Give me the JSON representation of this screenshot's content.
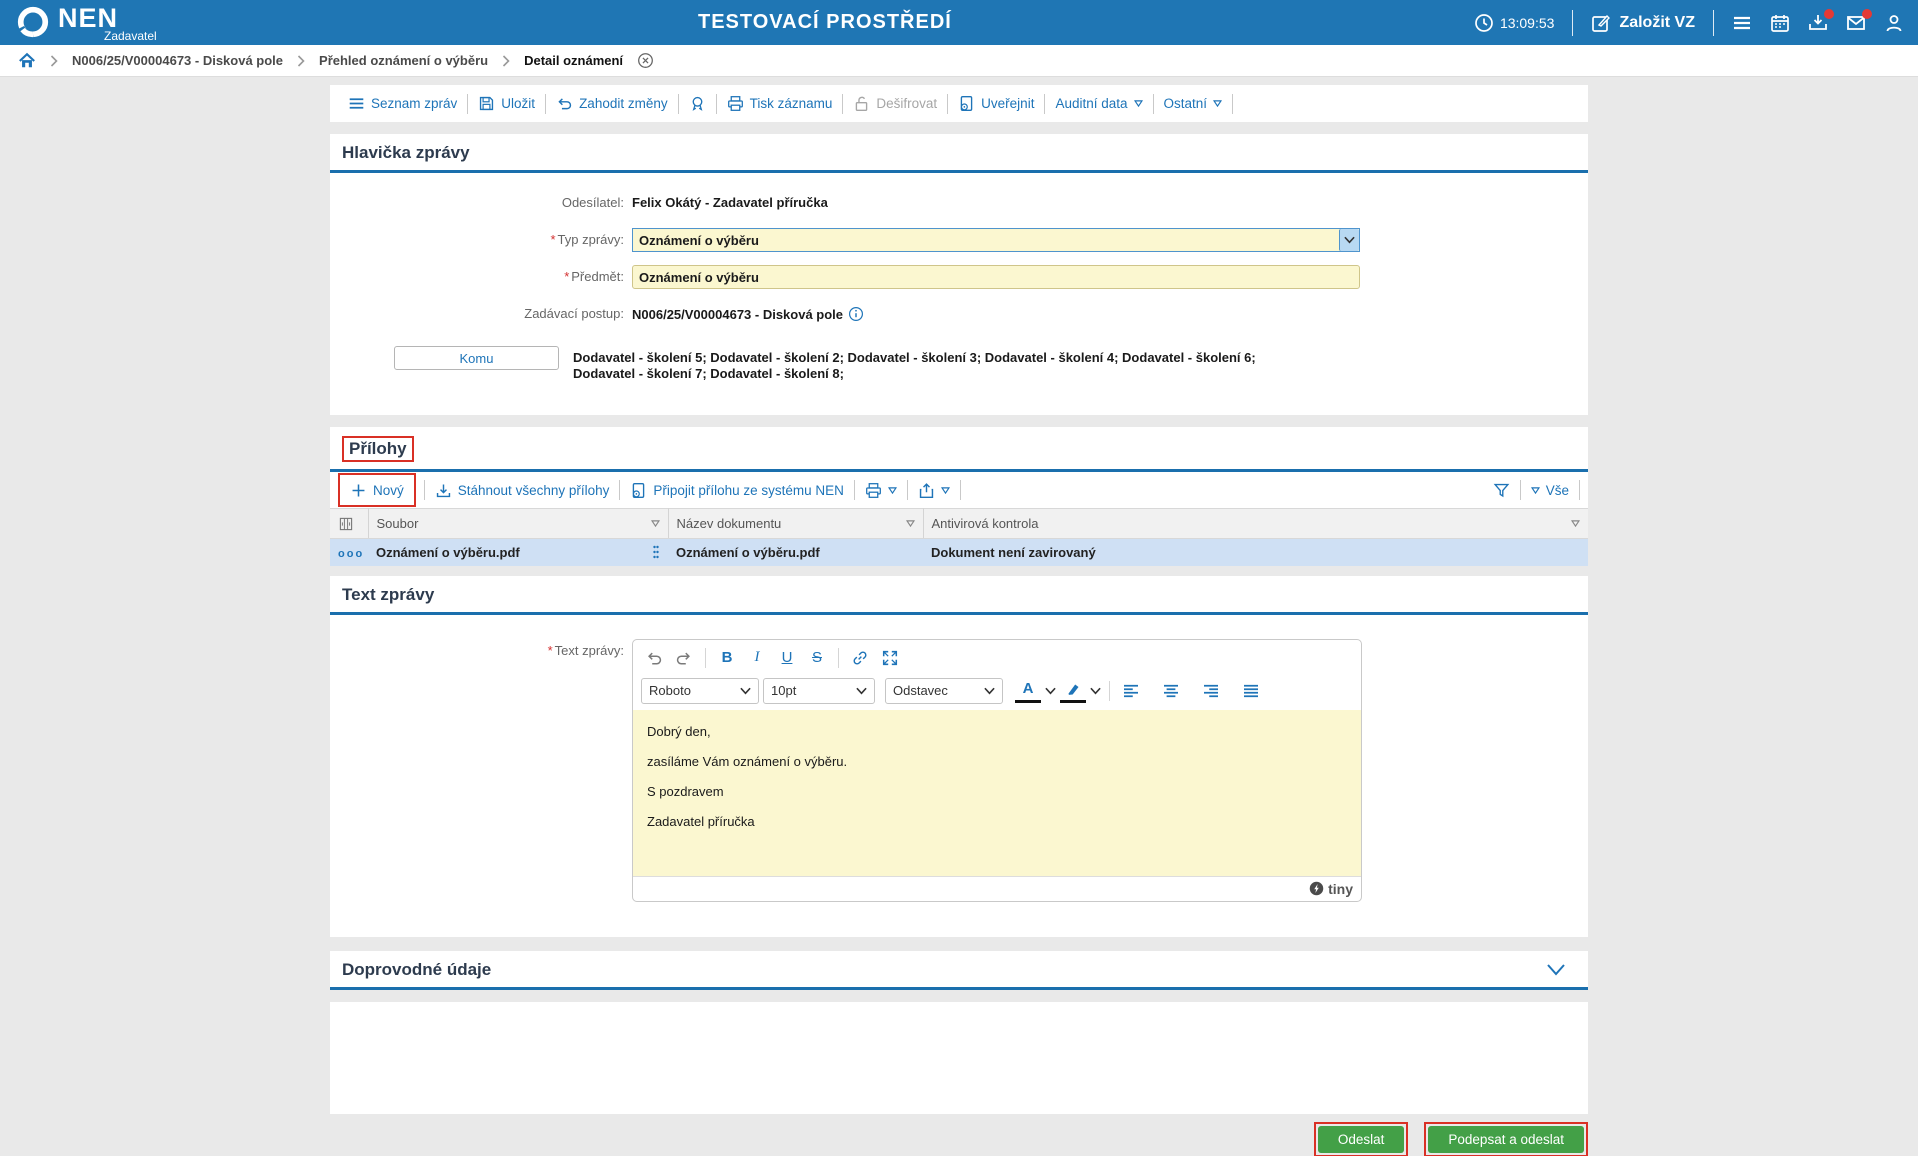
{
  "header": {
    "brand": "NEN",
    "subtitle": "Zadavatel",
    "env_title": "TESTOVACÍ PROSTŘEDÍ",
    "time": "13:09:53",
    "create_vz_label": "Založit VZ"
  },
  "breadcrumb": {
    "items": [
      "N006/25/V00004673 - Disková pole",
      "Přehled oznámení o výběru",
      "Detail oznámení"
    ]
  },
  "toolbar": {
    "items": [
      {
        "label": "Seznam zpráv"
      },
      {
        "label": "Uložit"
      },
      {
        "label": "Zahodit změny"
      },
      {
        "label": "Tisk záznamu"
      },
      {
        "label": "Dešifrovat"
      },
      {
        "label": "Uveřejnit"
      },
      {
        "label": "Auditní data"
      },
      {
        "label": "Ostatní"
      }
    ]
  },
  "message_header": {
    "title": "Hlavička zprávy",
    "sender_label": "Odesílatel:",
    "sender_value": "Felix Okátý - Zadavatel příručka",
    "type_label": "Typ zprávy:",
    "type_value": "Oznámení o výběru",
    "subject_label": "Předmět:",
    "subject_value": "Oznámení o výběru",
    "procedure_label": "Zadávací postup:",
    "procedure_value": "N006/25/V00004673 - Disková pole",
    "to_button_label": "Komu",
    "to_value": "Dodavatel - školení 5; Dodavatel - školení 2; Dodavatel - školení 3; Dodavatel - školení 4; Dodavatel - školení 6; Dodavatel - školení 7; Dodavatel - školení 8;"
  },
  "attachments": {
    "title": "Přílohy",
    "toolbar": {
      "new_label": "Nový",
      "download_all_label": "Stáhnout všechny přílohy",
      "attach_from_nen_label": "Připojit přílohu ze systému NEN",
      "all_label": "Vše"
    },
    "table": {
      "columns": [
        "Soubor",
        "Název dokumentu",
        "Antivirová kontrola"
      ],
      "rows": [
        {
          "file": "Oznámení o výběru.pdf",
          "document_name": "Oznámení o výběru.pdf",
          "antivirus": "Dokument není zavirovaný"
        }
      ]
    }
  },
  "message_body": {
    "title": "Text zprávy",
    "field_label": "Text zprávy:",
    "editor": {
      "font_value": "Roboto",
      "size_value": "10pt",
      "block_value": "Odstavec",
      "paragraphs": [
        "Dobrý den,",
        "zasíláme Vám oznámení o výběru.",
        "S pozdravem",
        "Zadavatel příručka"
      ],
      "brand": "tiny"
    }
  },
  "accompanying": {
    "title": "Doprovodné údaje"
  },
  "footer": {
    "send_label": "Odeslat",
    "sign_and_send_label": "Podepsat a odeslat"
  },
  "colors": {
    "header_bar": "#1f76b4",
    "accent_link": "#1e74b8",
    "section_rule": "#1a6fad",
    "field_yellow": "#fbf7d0",
    "selected_row": "#cfe0f4",
    "button_green": "#43a047",
    "annotation_red": "#d93025",
    "notification_red": "#e53935"
  }
}
